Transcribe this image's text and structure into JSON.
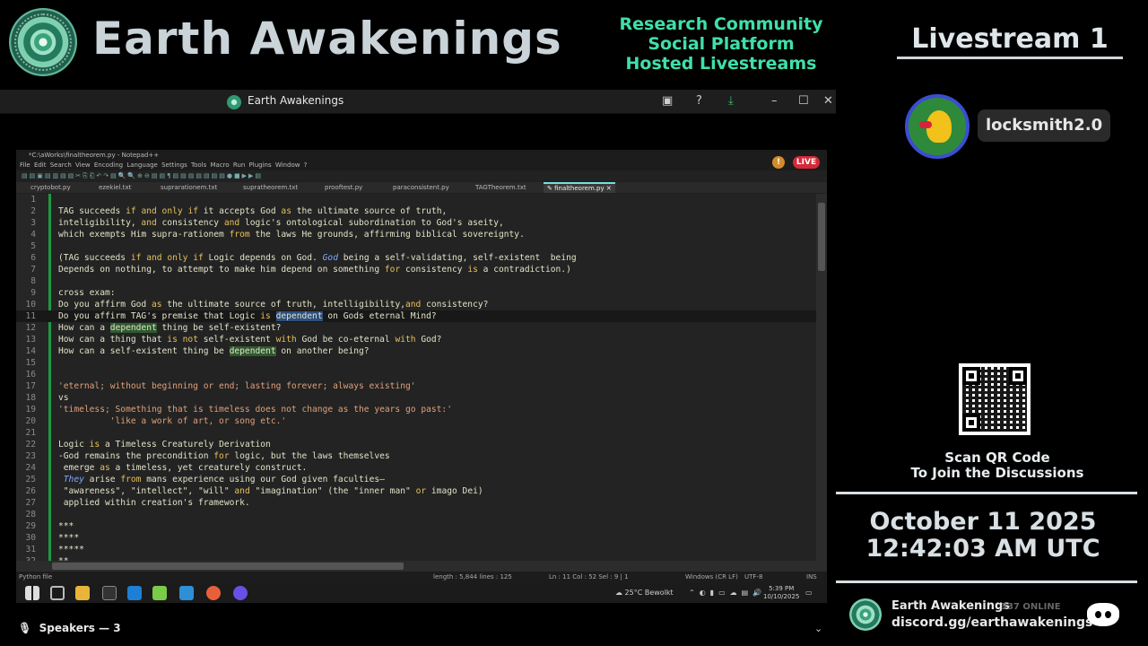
{
  "header": {
    "brand_title": "Earth Awakenings",
    "tagline": [
      "Research Community",
      "Social Platform",
      "Hosted Livestreams"
    ],
    "livestream_title": "Livestream 1"
  },
  "user": {
    "name": "locksmith2.0"
  },
  "share_window": {
    "title": "Earth Awakenings",
    "icons": [
      "screen-share-icon",
      "help-icon",
      "download-icon",
      "minimize-icon",
      "maximize-icon",
      "close-icon"
    ]
  },
  "notepad": {
    "title": "*C:\\aWorks\\finaltheorem.py - Notepad++",
    "menu": "File Edit Search View Encoding Language Settings Tools Macro Run Plugins Window ?",
    "live_badge": "LIVE",
    "tabs": [
      "cryptobot.py",
      "ezekiel.txt",
      "suprarationem.txt",
      "supratheorem.txt",
      "prooftest.py",
      "paraconsistent.py",
      "TAGTheorem.txt",
      "finaltheorem.py"
    ],
    "active_tab": "finaltheorem.py",
    "lines": [
      "",
      "TAG succeeds if and only if it accepts God as the ultimate source of truth,",
      "inteligibility, and consistency and logic's ontological subordination to God's aseity,",
      "which exempts Him supra-rationem from the laws He grounds, affirming biblical sovereignty.",
      "",
      "(TAG succeeds if and only if Logic depends on God. God being a self-validating, self-existent  being",
      "Depends on nothing, to attempt to make him depend on something for consistency is a contradiction.)",
      "",
      "cross exam:",
      "Do you affirm God as the ultimate source of truth, intelligibility,and consistency?",
      "Do you affirm TAG's premise that Logic is dependent on Gods eternal Mind?",
      "How can a dependent thing be self-existent?",
      "How can a thing that is not self-existent with God be co-eternal with God?",
      "How can a self-existent thing be dependent on another being?",
      "",
      "",
      "'eternal; without beginning or end; lasting forever; always existing'",
      "vs",
      "'timeless; Something that is timeless does not change as the years go past:'",
      "          'like a work of art, or song etc.'",
      "",
      "Logic is a Timeless Creaturely Derivation",
      "-God remains the precondition for logic, but the laws themselves",
      " emerge as a timeless, yet creaturely construct.",
      " They arise from mans experience using our God given faculties—",
      " \"awareness\", \"intellect\", \"will\" and \"imagination\" (the \"inner man\" or imago Dei)",
      " applied within creation's framework.",
      "",
      "***",
      "****",
      "*****",
      "**"
    ],
    "status": {
      "language": "Python file",
      "length": "length : 5,844    lines : 125",
      "position": "Ln : 11    Col : 52    Sel : 9 | 1",
      "eol": "Windows (CR LF)",
      "encoding": "UTF-8",
      "mode": "INS"
    }
  },
  "taskbar": {
    "weather": "25°C  Bewolkt",
    "time": "5:39 PM",
    "date": "10/10/2025"
  },
  "speakers": "Speakers — 3",
  "qr": {
    "caption_1": "Scan QR Code",
    "caption_2": "To Join the Discussions"
  },
  "datetime": {
    "date": "October 11 2025",
    "time": "12:42:03 AM UTC"
  },
  "discord": {
    "name": "Earth Awakenings",
    "online": "337 ONLINE",
    "url": "discord.gg/earthawakenings"
  }
}
